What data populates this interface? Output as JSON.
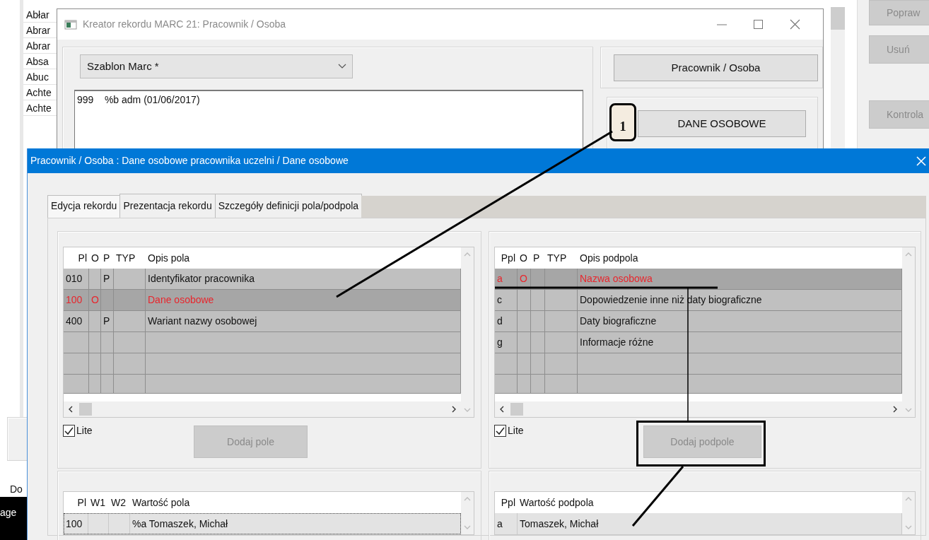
{
  "background_app": {
    "list_items": [
      "Abłar",
      "Abrar",
      "Abrar",
      "Absa",
      "Abuc",
      "Achte",
      "Achte"
    ],
    "buttons": [
      {
        "label": "Popraw",
        "disabled": true
      },
      {
        "label": "Usuń",
        "disabled": true
      },
      {
        "label": "Kontrola",
        "disabled": true
      }
    ],
    "bottom_label": "Do",
    "dark_strip_text": "age"
  },
  "wizard": {
    "title": "Kreator rekordu MARC 21: Pracownik / Osoba",
    "template_select": "Szablon Marc *",
    "record_text": "999    %b adm (01/06/2017)",
    "buttons": [
      {
        "label": "Pracownik / Osoba",
        "disabled": false
      },
      {
        "label": "DANE OSOBOWE",
        "disabled": false
      }
    ]
  },
  "dialog": {
    "title": "Pracownik / Osoba : Dane osobowe pracownika uczelni / Dane osobowe",
    "tabs": [
      {
        "label": "Edycja rekordu",
        "selected": true
      },
      {
        "label": "Prezentacja rekordu",
        "selected": false
      },
      {
        "label": "Szczegóły definicji pola/podpola",
        "selected": false
      }
    ],
    "fields_table": {
      "columns": [
        "Pl",
        "O",
        "P",
        "TYP",
        "Opis pola"
      ],
      "rows": [
        {
          "cells": [
            "010",
            "",
            "P",
            "",
            "Identyfikator pracownika"
          ],
          "selected": false
        },
        {
          "cells": [
            "100",
            "O",
            "",
            "",
            "Dane osobowe"
          ],
          "selected": true
        },
        {
          "cells": [
            "400",
            "",
            "P",
            "",
            "Wariant nazwy osobowej"
          ],
          "selected": false
        }
      ],
      "lite": {
        "label": "Lite",
        "checked": true
      },
      "add_button": {
        "label": "Dodaj pole",
        "disabled": true
      }
    },
    "subfields_table": {
      "columns": [
        "Ppl",
        "O",
        "P",
        "TYP",
        "Opis podpola"
      ],
      "rows": [
        {
          "cells": [
            "a",
            "O",
            "",
            "",
            "Nazwa osobowa"
          ],
          "selected": true
        },
        {
          "cells": [
            "c",
            "",
            "",
            "",
            "Dopowiedzenie inne niż daty biograficzne"
          ],
          "selected": false
        },
        {
          "cells": [
            "d",
            "",
            "",
            "",
            "Daty biograficzne"
          ],
          "selected": false
        },
        {
          "cells": [
            "g",
            "",
            "",
            "",
            "Informacje różne"
          ],
          "selected": false
        }
      ],
      "lite": {
        "label": "Lite",
        "checked": true
      },
      "add_button": {
        "label": "Dodaj podpole",
        "disabled": true
      }
    },
    "field_values_table": {
      "columns": [
        "Pl",
        "W1",
        "W2",
        "Wartość pola"
      ],
      "rows": [
        {
          "cells": [
            "100",
            "",
            "",
            "%a Tomaszek, Michał"
          ],
          "focused": true
        }
      ]
    },
    "subfield_values_table": {
      "columns": [
        "Ppl",
        "Wartość podpola"
      ],
      "rows": [
        {
          "cells": [
            "a",
            "Tomaszek, Michał"
          ],
          "focused": false
        }
      ]
    }
  },
  "annotation": {
    "callout": "1"
  }
}
